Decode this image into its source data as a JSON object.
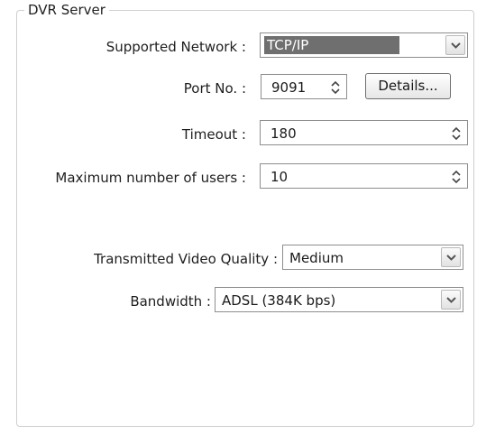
{
  "group": {
    "title": "DVR Server"
  },
  "network": {
    "label": "Supported Network :",
    "value": "TCP/IP"
  },
  "port": {
    "label": "Port No. :",
    "value": "9091",
    "details_label": "Details..."
  },
  "timeout": {
    "label": "Timeout :",
    "value": "180"
  },
  "max_users": {
    "label": "Maximum number of users :",
    "value": "10"
  },
  "video_quality": {
    "label": "Transmitted Video Quality :",
    "value": "Medium"
  },
  "bandwidth": {
    "label": "Bandwidth :",
    "value": "ADSL (384K bps)"
  }
}
